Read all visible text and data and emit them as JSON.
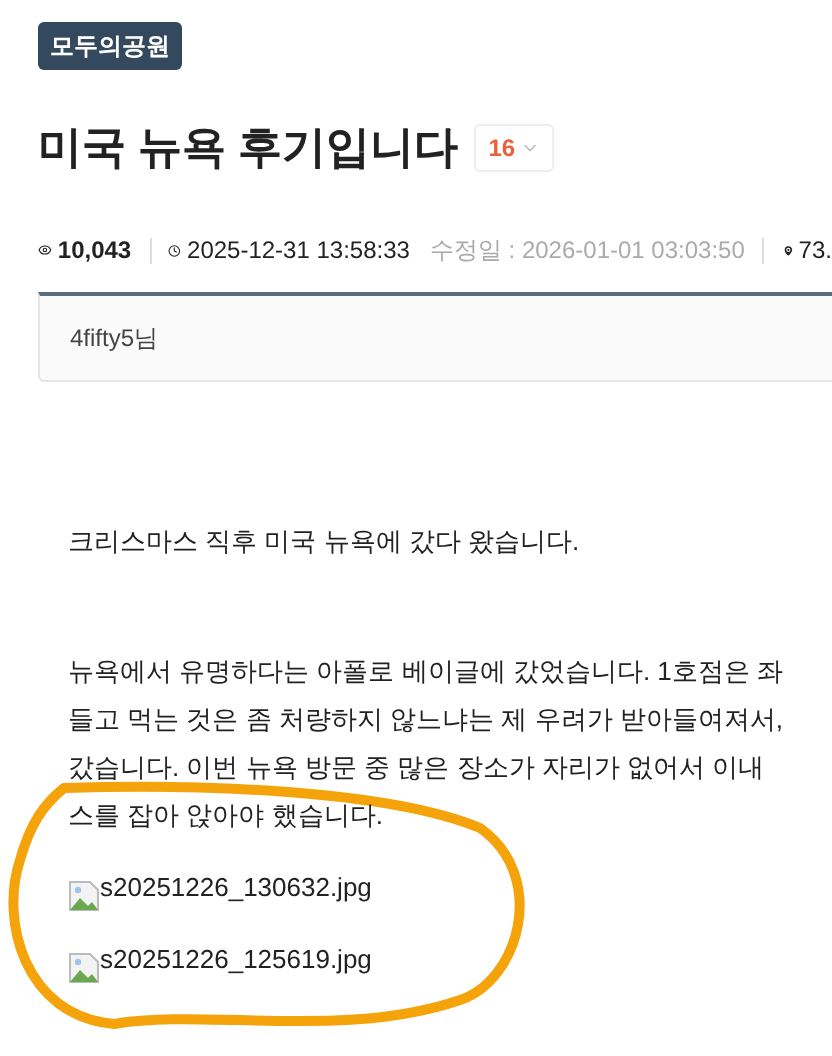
{
  "category_badge": "모두의공원",
  "title": "미국 뉴욕 후기입니다",
  "comment_count": "16",
  "meta": {
    "views": "10,043",
    "posted": "2025-12-31 13:58:33",
    "edited": "수정일 : 2026-01-01 03:03:50",
    "ip": "73."
  },
  "author": "4fifty5님",
  "body": [
    {
      "kind": "text",
      "lines": [
        "크리스마스 직후 미국 뉴욕에 갔다 왔습니다."
      ]
    },
    {
      "kind": "text",
      "lines": [
        "뉴욕에서 유명하다는 아폴로 베이글에 갔었습니다.  1호점은 좌",
        "들고 먹는 것은 좀 처량하지 않느냐는 제 우려가 받아들여져서,",
        "갔습니다.  이번 뉴욕 방문 중 많은 장소가 자리가 없어서 이내",
        "스를 잡아 앉아야 했습니다."
      ]
    },
    {
      "kind": "image",
      "alt": "s20251226_130632.jpg"
    },
    {
      "kind": "image",
      "alt": "s20251226_125619.jpg"
    }
  ]
}
